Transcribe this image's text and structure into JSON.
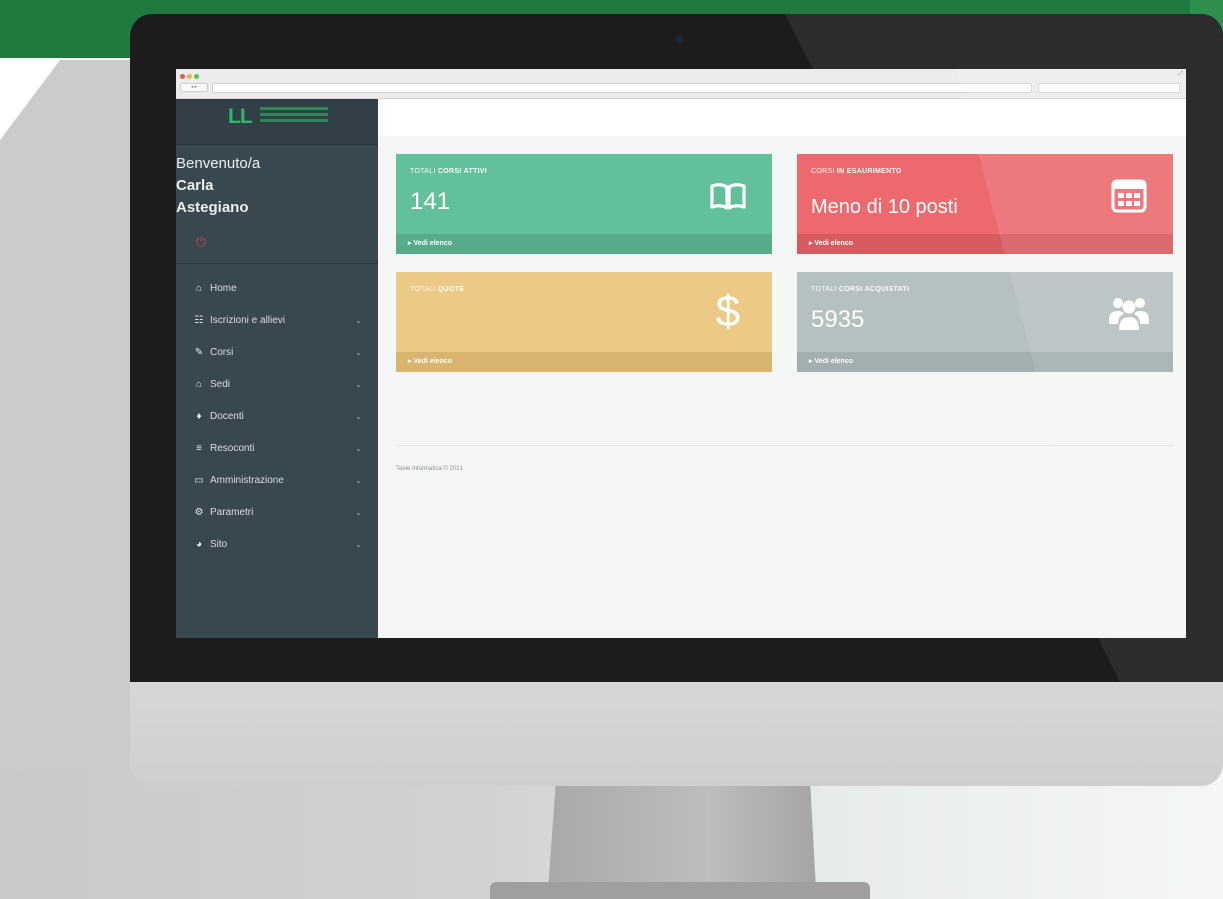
{
  "browser": {
    "nav_buttons": "◂ ▸",
    "resize_icon": "⤢"
  },
  "sidebar": {
    "logo_mark": "LL",
    "welcome": "Benvenuto/a",
    "user_first_name": "Carla",
    "user_last_name": "Astegiano",
    "items": [
      {
        "label": "Home",
        "icon": "home-icon",
        "glyph": "⌂",
        "has_submenu": false
      },
      {
        "label": "Iscrizioni e allievi",
        "icon": "users-icon",
        "glyph": "👥",
        "has_submenu": true
      },
      {
        "label": "Corsi",
        "icon": "pencil-icon",
        "glyph": "✎",
        "has_submenu": true
      },
      {
        "label": "Sedi",
        "icon": "home-icon",
        "glyph": "⌂",
        "has_submenu": true
      },
      {
        "label": "Docenti",
        "icon": "user-icon",
        "glyph": "♦",
        "has_submenu": true
      },
      {
        "label": "Resoconti",
        "icon": "list-icon",
        "glyph": "≡",
        "has_submenu": true
      },
      {
        "label": "Amministrazione",
        "icon": "monitor-icon",
        "glyph": "▭",
        "has_submenu": true
      },
      {
        "label": "Parametri",
        "icon": "gear-icon",
        "glyph": "⚙",
        "has_submenu": true
      },
      {
        "label": "Sito",
        "icon": "globe-icon",
        "glyph": "◕",
        "has_submenu": true
      }
    ]
  },
  "cards": [
    {
      "label_prefix": "Totali",
      "label_bold": "corsi attivi",
      "value": "141",
      "icon": "book-icon",
      "footer": "Vedi elenco",
      "color": "#62c19b"
    },
    {
      "label_prefix": "Corsi",
      "label_bold": "in esaurimento",
      "value": "Meno di 10 posti",
      "icon": "calendar-icon",
      "footer": "Vedi elenco",
      "color": "#ec6a6e"
    },
    {
      "label_prefix": "Totali",
      "label_bold": "quote",
      "value": "",
      "icon": "dollar-icon",
      "footer": "Vedi elenco",
      "color": "#ecc985"
    },
    {
      "label_prefix": "Totali",
      "label_bold": "corsi acquistati",
      "value": "5935",
      "icon": "users-icon",
      "footer": "Vedi elenco",
      "color": "#b5c0c1"
    }
  ],
  "footer": {
    "text": "Teeie Informatica © 2021"
  },
  "colors": {
    "brand_green": "#207a40",
    "sidebar": "#39474f",
    "accent_red": "#e0413e"
  }
}
